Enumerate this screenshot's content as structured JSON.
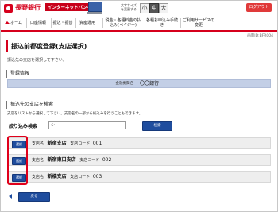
{
  "header": {
    "bank_name": "長野銀行",
    "service_label": "インターネットバンキング",
    "font_size_label": "文字サイズを変更する",
    "font_sizes": [
      "小",
      "中",
      "大"
    ],
    "logout_label": "ログアウト"
  },
  "nav": {
    "items": [
      {
        "label": "ホーム"
      },
      {
        "label": "口座情報"
      },
      {
        "label": "振込・振替"
      },
      {
        "label": "資産運用"
      },
      {
        "label": "税金・各種料金の払込み(ペイジー)"
      },
      {
        "label": "各種お申込み手続き"
      },
      {
        "label": "ご利用サービスの変更"
      }
    ]
  },
  "screen_id": "画面ID:BFR004",
  "page": {
    "title": "振込前都度登録(支店選択)",
    "instruction": "振込先の支店を選択して下さい。"
  },
  "registration": {
    "heading": "登録情報",
    "bank_label": "金融機関名",
    "bank_value": "〇〇銀行"
  },
  "search": {
    "heading": "振込先の支店を検索",
    "description": "支店をリストから選択して下さい。支店名の一部から絞込みを行うこともできます。",
    "refine_label": "絞り込み検索",
    "input_value": "シ",
    "button_label": "検索"
  },
  "branches": {
    "select_label": "選択",
    "name_label": "支店名",
    "code_label": "支店コード",
    "rows": [
      {
        "name": "新宿支店",
        "code": "001"
      },
      {
        "name": "新宿東口支店",
        "code": "002"
      },
      {
        "name": "新橋支店",
        "code": "003"
      }
    ]
  },
  "back_label": "戻る",
  "colors": {
    "brand_red": "#d6001c",
    "button_blue": "#1f4d9e",
    "info_row": "#c3cfe6",
    "list_row": "#eeeeee"
  }
}
